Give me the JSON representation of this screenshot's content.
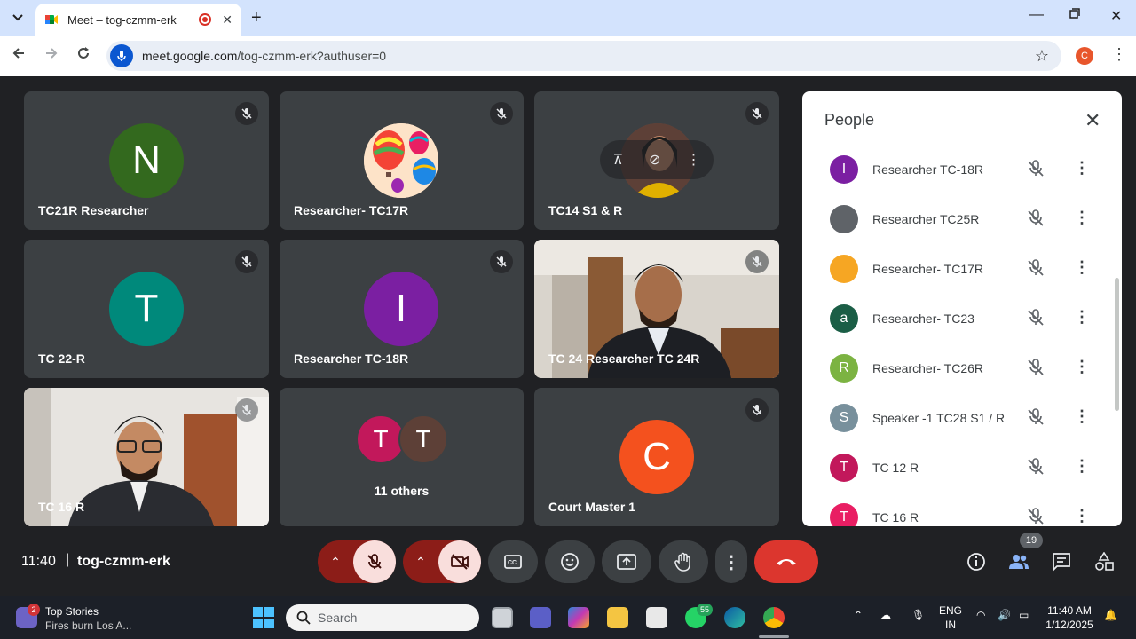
{
  "browser": {
    "tab_title": "Meet – tog-czmm-erk",
    "url_host": "meet.google.com",
    "url_path": "/tog-czmm-erk?authuser=0",
    "profile_initial": "C"
  },
  "tiles": [
    {
      "name": "TC21R Researcher",
      "initial": "N",
      "color": "#33691e"
    },
    {
      "name": "Researcher- TC17R",
      "initial": "",
      "color": ""
    },
    {
      "name": "TC14 S1 & R",
      "initial": "",
      "color": ""
    },
    {
      "name": "TC 22-R",
      "initial": "T",
      "color": "#00897b"
    },
    {
      "name": "Researcher TC-18R",
      "initial": "I",
      "color": "#7b1fa2"
    },
    {
      "name": "TC 24 Researcher TC 24R",
      "initial": "",
      "color": ""
    },
    {
      "name": "TC 16 R",
      "initial": "",
      "color": ""
    },
    {
      "name": "11 others",
      "initial": "T",
      "color": "#c2185b"
    },
    {
      "name": "Court Master 1",
      "initial": "C",
      "color": "#f4511e"
    }
  ],
  "others_second_initial": "T",
  "people_panel": {
    "title": "People",
    "participants": [
      {
        "name": "Researcher TC-18R",
        "initial": "I",
        "color": "#7b1fa2"
      },
      {
        "name": "Researcher TC25R",
        "initial": "",
        "color": "#5f6368"
      },
      {
        "name": "Researcher- TC17R",
        "initial": "",
        "color": "#f6a623"
      },
      {
        "name": "Researcher- TC23",
        "initial": "a",
        "color": "#1b5e46"
      },
      {
        "name": "Researcher- TC26R",
        "initial": "R",
        "color": "#7cb342"
      },
      {
        "name": "Speaker -1 TC28 S1 / R",
        "initial": "S",
        "color": "#78909c"
      },
      {
        "name": "TC 12 R",
        "initial": "T",
        "color": "#c2185b"
      },
      {
        "name": "TC 16 R",
        "initial": "T",
        "color": "#e91e63"
      }
    ]
  },
  "bottom_bar": {
    "time": "11:40",
    "separator": "|",
    "meeting_code": "tog-czmm-erk",
    "people_count": "19"
  },
  "taskbar": {
    "news_title": "Top Stories",
    "news_sub": "Fires burn Los A...",
    "news_badge": "2",
    "search_placeholder": "Search",
    "whatsapp_badge": "55",
    "lang_line1": "ENG",
    "lang_line2": "IN",
    "clock_time": "11:40 AM",
    "clock_date": "1/12/2025"
  }
}
